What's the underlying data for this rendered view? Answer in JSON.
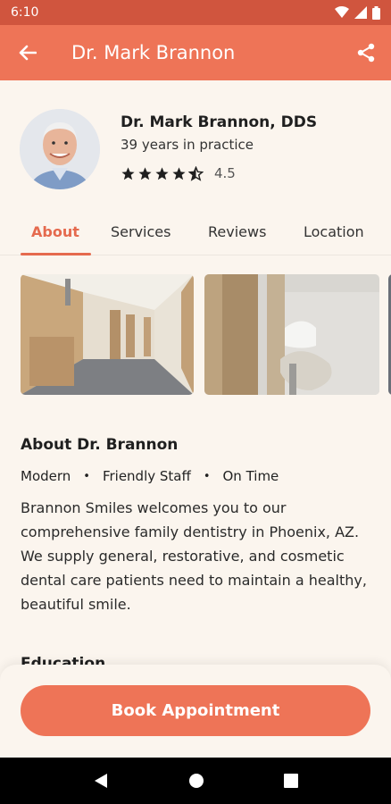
{
  "status_bar": {
    "time": "6:10"
  },
  "app_bar": {
    "title": "Dr. Mark Brannon"
  },
  "profile": {
    "name": "Dr. Mark Brannon, DDS",
    "years": "39 years in practice",
    "rating": "4.5"
  },
  "tabs": [
    {
      "label": "About"
    },
    {
      "label": "Services"
    },
    {
      "label": "Reviews"
    },
    {
      "label": "Location"
    }
  ],
  "about": {
    "title": "About Dr. Brannon",
    "tags": [
      "Modern",
      "Friendly Staff",
      "On Time"
    ],
    "text": "Brannon Smiles welcomes you to our comprehensive family dentistry in Phoenix, AZ. We supply general, restorative, and cosmetic dental care patients need to maintain a healthy, beautiful smile."
  },
  "education": {
    "heading": "Education"
  },
  "booking": {
    "button_label": "Book Appointment"
  },
  "colors": {
    "accent": "#ee7457",
    "status_bar": "#d0553e",
    "background": "#fbf5ee"
  }
}
